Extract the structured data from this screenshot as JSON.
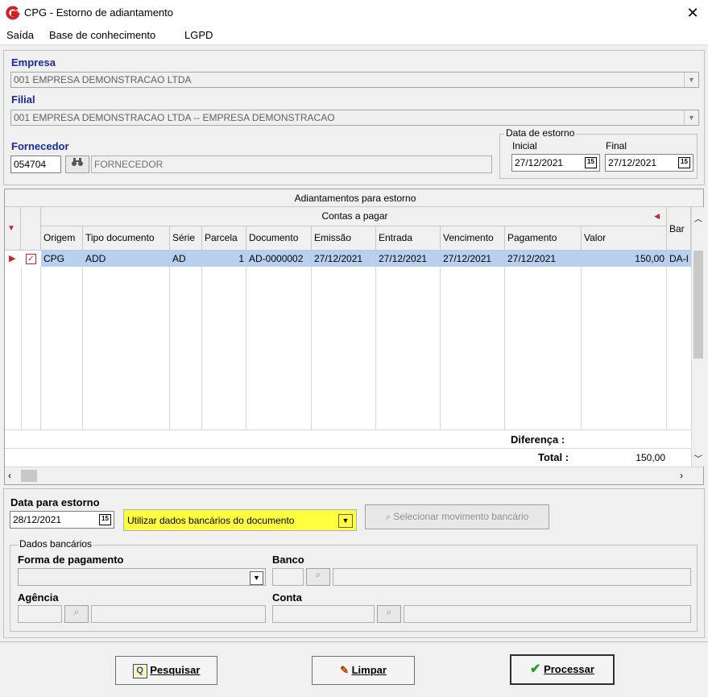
{
  "window": {
    "title": "CPG - Estorno de adiantamento",
    "close_glyph": "✕"
  },
  "menu": [
    {
      "label": "Saída"
    },
    {
      "label": "Base de conhecimento"
    },
    {
      "label": "LGPD"
    }
  ],
  "empresa": {
    "label": "Empresa",
    "value": "001 EMPRESA DEMONSTRACAO LTDA"
  },
  "filial": {
    "label": "Filial",
    "value": "001 EMPRESA DEMONSTRACAO LTDA -- EMPRESA DEMONSTRACAO"
  },
  "fornecedor": {
    "label": "Fornecedor",
    "code": "054704",
    "name": "FORNECEDOR"
  },
  "data_estorno_group": {
    "title": "Data de estorno",
    "inicial_label": "Inicial",
    "inicial_value": "27/12/2021",
    "final_label": "Final",
    "final_value": "27/12/2021"
  },
  "grid": {
    "caption": "Adiantamentos para estorno",
    "band": "Contas a pagar",
    "extra_col": "Bar",
    "columns": [
      "Origem",
      "Tipo documento",
      "Série",
      "Parcela",
      "Documento",
      "Emissão",
      "Entrada",
      "Vencimento",
      "Pagamento",
      "Valor"
    ],
    "rows": [
      {
        "origem": "CPG",
        "tipo": "ADD",
        "serie": "AD",
        "parcela": "1",
        "documento": "AD-0000002",
        "emissao": "27/12/2021",
        "entrada": "27/12/2021",
        "vencimento": "27/12/2021",
        "pagamento": "27/12/2021",
        "valor": "150,00",
        "banco": "DA-I",
        "checked": true
      }
    ],
    "diferenca_label": "Diferença :",
    "total_label": "Total :",
    "total_value": "150,00"
  },
  "data_para_estorno": {
    "label": "Data para estorno",
    "value": "28/12/2021"
  },
  "dados_option": {
    "value": "Utilizar dados bancários do documento",
    "highlight_color": "#ffff40"
  },
  "selecionar_mov": {
    "label": "Selecionar movimento bancário"
  },
  "dados_bancarios": {
    "title": "Dados bancários",
    "forma_label": "Forma de pagamento",
    "banco_label": "Banco",
    "agencia_label": "Agência",
    "conta_label": "Conta"
  },
  "buttons": {
    "pesquisar": "Pesquisar",
    "limpar": "Limpar",
    "processar": "Processar"
  },
  "calendar_glyph": "15",
  "colors": {
    "brand_red": "#d0202a",
    "label_blue": "#1a2aa0",
    "selection": "#b8d0f0"
  }
}
